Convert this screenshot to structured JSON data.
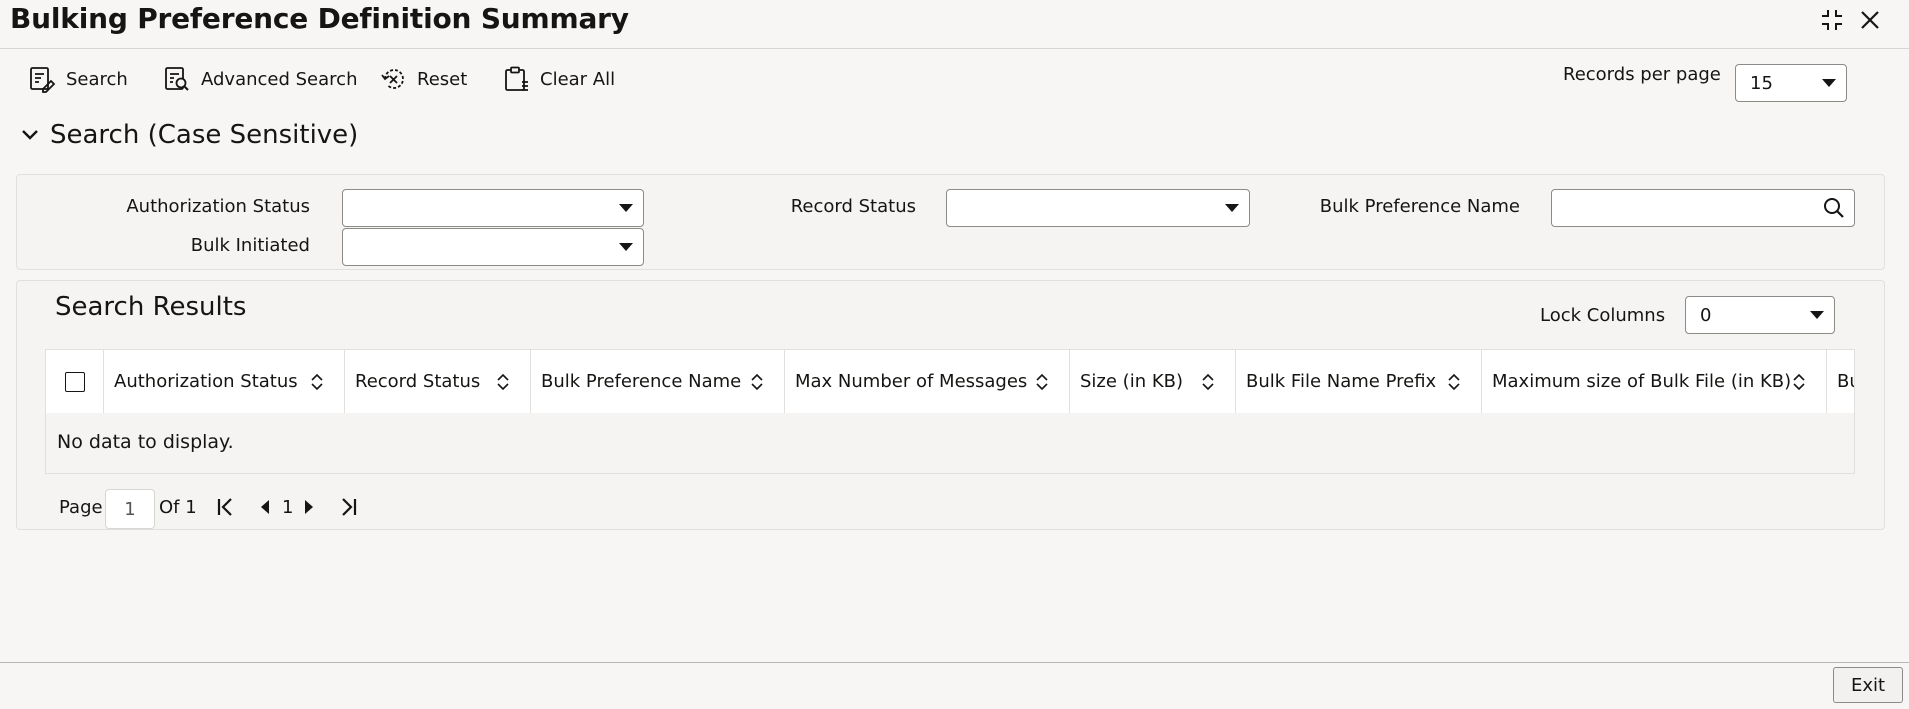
{
  "page": {
    "title": "Bulking Preference Definition Summary"
  },
  "toolbar": {
    "search_label": "Search",
    "advanced_search_label": "Advanced Search",
    "reset_label": "Reset",
    "clear_all_label": "Clear All",
    "records_per_page_label": "Records per page",
    "records_per_page_value": "15"
  },
  "search_section": {
    "heading": "Search (Case Sensitive)",
    "authorization_status_label": "Authorization Status",
    "authorization_status_value": "",
    "record_status_label": "Record Status",
    "record_status_value": "",
    "bulk_preference_name_label": "Bulk Preference Name",
    "bulk_preference_name_value": "",
    "bulk_initiated_label": "Bulk Initiated",
    "bulk_initiated_value": ""
  },
  "results": {
    "heading": "Search Results",
    "lock_columns_label": "Lock Columns",
    "lock_columns_value": "0",
    "columns": [
      "Authorization Status",
      "Record Status",
      "Bulk Preference Name",
      "Max Number of Messages",
      "Size (in KB)",
      "Bulk File Name Prefix",
      "Maximum size of Bulk File (in KB)",
      "Bu"
    ],
    "empty_message": "No data to display."
  },
  "pagination": {
    "page_label": "Page",
    "current_page": "1",
    "of_label": "Of 1",
    "page_number": "1"
  },
  "footer": {
    "exit_label": "Exit"
  },
  "colors": {
    "background": "#f7f6f4",
    "panel": "#f5f4f2",
    "border": "#8c8a87",
    "text": "#161513"
  }
}
